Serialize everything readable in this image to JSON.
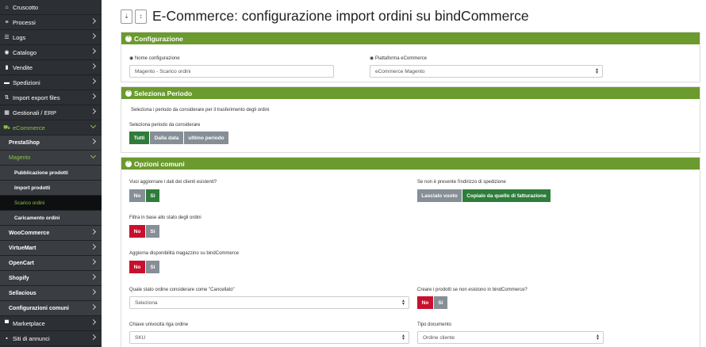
{
  "sidebar": {
    "items": [
      {
        "label": "Cruscotto",
        "icon": "home-icon",
        "glyph": "⌂"
      },
      {
        "label": "Processi",
        "icon": "processes-icon",
        "glyph": "≡"
      },
      {
        "label": "Logs",
        "icon": "logs-icon",
        "glyph": "☰"
      },
      {
        "label": "Catalogo",
        "icon": "catalog-icon",
        "glyph": "◉"
      },
      {
        "label": "Vendite",
        "icon": "sales-icon",
        "glyph": "▮"
      },
      {
        "label": "Spedizioni",
        "icon": "shipping-icon",
        "glyph": "▬"
      },
      {
        "label": "Import export files",
        "icon": "import-export-icon",
        "glyph": "⇅"
      },
      {
        "label": "Gestionali / ERP",
        "icon": "erp-icon",
        "glyph": "▦"
      },
      {
        "label": "eCommerce",
        "icon": "cart-icon",
        "glyph": "🛒"
      },
      {
        "label": "PrestaShop"
      },
      {
        "label": "Magento"
      },
      {
        "label": "Pubblicazione prodotti"
      },
      {
        "label": "Import prodotti"
      },
      {
        "label": "Scarico ordini"
      },
      {
        "label": "Caricamento ordini"
      },
      {
        "label": "WooCommerce"
      },
      {
        "label": "VirtueMart"
      },
      {
        "label": "OpenCart"
      },
      {
        "label": "Shopify"
      },
      {
        "label": "Sellacious"
      },
      {
        "label": "Configurazioni comuni"
      },
      {
        "label": "Marketplace",
        "icon": "marketplace-icon",
        "glyph": "▀"
      },
      {
        "label": "Siti di annunci",
        "icon": "ads-icon",
        "glyph": "▪"
      }
    ]
  },
  "header": {
    "title": "E-Commerce: configurazione import ordini su bindCommerce",
    "btn1": "⇣",
    "btn2": "↕"
  },
  "configurazione": {
    "title": "Configurazione",
    "name_label": "Nome configurazione",
    "name_value": "Magento - Scarico ordini",
    "platform_label": "Piattaforma eCommerce",
    "platform_value": "eCommerce Magento"
  },
  "periodo": {
    "title": "Seleziona Periodo",
    "description": "Seleziona i periodo da considerare per il trasferimento degli ordini",
    "select_label": "Seleziona periodo da considerare",
    "opt_all": "Tutti",
    "opt_from": "Dalla data",
    "opt_last": "ultimo periodo"
  },
  "opzioni": {
    "title": "Opzioni comuni",
    "update_clients_label": "Vuoi aggiornare i dati dei clienti esistenti?",
    "shipping_label": "Se non è presente l'indirizzo di spedizione",
    "shipping_empty": "Lascialo vuoto",
    "shipping_copy": "Copialo da quello di fatturazione",
    "filter_label": "Filtra in base allo stato degli ordini",
    "stock_label": "Aggiorna disponibilità magazzino su bindCommerce",
    "cancel_label": "Quale stato ordine considerare come \"Cancellato\"",
    "cancel_value": "Seleziona",
    "create_products_label": "Creare i prodotti se non esistono in bindCommerce?",
    "key_label": "Chiave univocità riga ordine",
    "key_value": "SKU",
    "doc_type_label": "Tipo documento",
    "doc_type_value": "Ordine cliente",
    "no": "No",
    "si": "Si"
  },
  "colors": {
    "panel_header": "#6b9a2e",
    "sidebar_bg": "#2c2f33",
    "active_green": "#8bc34a",
    "btn_green": "#2e7d3a",
    "btn_grey": "#868e96",
    "btn_red": "#c8102e"
  }
}
